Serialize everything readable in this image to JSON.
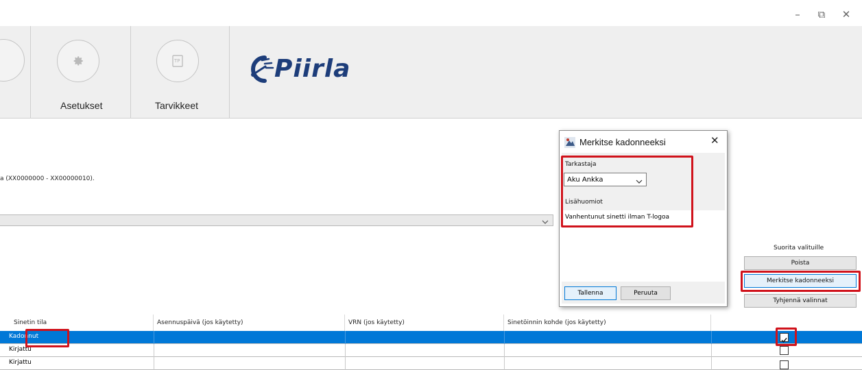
{
  "window": {
    "minimize_glyph": "–",
    "restore_glyph": "⧉",
    "close_glyph": "✕"
  },
  "toolbar": {
    "settings_label": "Asetukset",
    "supplies_label": "Tarvikkeet",
    "logo_text": "Piirla",
    "settings_icon": "gear-icon",
    "supplies_icon": "tp-icon"
  },
  "main": {
    "range_text": "a (XX0000000 -  XX00000010).",
    "combo_value": ""
  },
  "side_panel": {
    "heading": "Suorita valituille",
    "delete_label": "Poista",
    "mark_lost_label": "Merkitse kadonneeksi",
    "clear_label": "Tyhjennä valinnat"
  },
  "table": {
    "columns": [
      "Sinetin tila",
      "Asennuspäivä (jos käytetty)",
      "VRN (jos käytetty)",
      "Sinetöinnin kohde (jos käytetty)"
    ],
    "rows": [
      {
        "status": "Kadonnut",
        "checked": true
      },
      {
        "status": "Kirjattu",
        "checked": false
      },
      {
        "status": "Kirjattu",
        "checked": false
      }
    ]
  },
  "dialog": {
    "title": "Merkitse kadonneeksi",
    "inspector_label": "Tarkastaja",
    "inspector_value": "Aku Ankka",
    "notes_label": "Lisähuomiot",
    "notes_value": "Vanhentunut sinetti ilman T-logoa",
    "save_label": "Tallenna",
    "cancel_label": "Peruuta"
  },
  "colors": {
    "selection": "#0078d7",
    "highlight": "#d0121b",
    "logo": "#1d3d7a"
  }
}
